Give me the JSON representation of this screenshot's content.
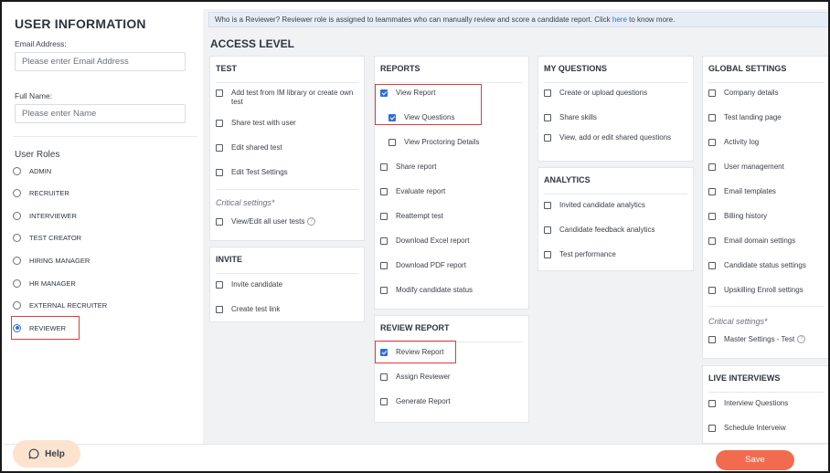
{
  "user_info": {
    "title": "USER INFORMATION",
    "email_label": "Email Address:",
    "email_placeholder": "Please enter Email Address",
    "name_label": "Full Name:",
    "name_placeholder": "Please enter Name",
    "roles_heading": "User Roles",
    "roles": [
      {
        "label": "ADMIN",
        "selected": false
      },
      {
        "label": "RECRUITER",
        "selected": false
      },
      {
        "label": "INTERVIEWER",
        "selected": false
      },
      {
        "label": "TEST CREATOR",
        "selected": false
      },
      {
        "label": "HIRING MANAGER",
        "selected": false
      },
      {
        "label": "HR MANAGER",
        "selected": false
      },
      {
        "label": "EXTERNAL RECRUITER",
        "selected": false
      },
      {
        "label": "REVIEWER",
        "selected": true
      }
    ]
  },
  "banner": {
    "text_before": "Who is a Reviewer?  Reviewer role is assigned to teammates who can manually review and score a candidate report. Click ",
    "link": "here",
    "text_after": " to know more."
  },
  "access_title": "ACCESS LEVEL",
  "test": {
    "title": "TEST",
    "items": [
      {
        "label": "Add test from IM library or create own test",
        "checked": false
      },
      {
        "label": "Share test with user",
        "checked": false
      },
      {
        "label": "Edit shared test",
        "checked": false
      },
      {
        "label": "Edit Test Settings",
        "checked": false
      }
    ],
    "critical_label": "Critical settings*",
    "critical_items": [
      {
        "label": "View/Edit all user tests",
        "checked": false,
        "help_icon": "question-circle-icon"
      }
    ]
  },
  "invite": {
    "title": "INVITE",
    "items": [
      {
        "label": "Invite candidate",
        "checked": false
      },
      {
        "label": "Create test link",
        "checked": false
      }
    ]
  },
  "reports": {
    "title": "REPORTS",
    "items": [
      {
        "label": "View Report",
        "checked": true
      },
      {
        "label": "View Questions",
        "checked": true
      },
      {
        "label": "View Proctoring Details",
        "checked": false
      },
      {
        "label": "Share report",
        "checked": false
      },
      {
        "label": "Evaluate report",
        "checked": false
      },
      {
        "label": "Reattempt test",
        "checked": false
      },
      {
        "label": "Download Excel report",
        "checked": false
      },
      {
        "label": "Download PDF report",
        "checked": false
      },
      {
        "label": "Modify candidate status",
        "checked": false
      }
    ]
  },
  "review_report": {
    "title": "REVIEW REPORT",
    "items": [
      {
        "label": "Review Report",
        "checked": true
      },
      {
        "label": "Assign Reviewer",
        "checked": false
      },
      {
        "label": "Generate Report",
        "checked": false
      }
    ]
  },
  "my_questions": {
    "title": "MY QUESTIONS",
    "items": [
      {
        "label": "Create or upload questions",
        "checked": false
      },
      {
        "label": "Share skills",
        "checked": false
      },
      {
        "label": "View, add or edit shared questions",
        "checked": false
      }
    ]
  },
  "analytics": {
    "title": "ANALYTICS",
    "items": [
      {
        "label": "Invited candidate analytics",
        "checked": false
      },
      {
        "label": "Candidate feedback analytics",
        "checked": false
      },
      {
        "label": "Test performance",
        "checked": false
      }
    ]
  },
  "global_settings": {
    "title": "GLOBAL SETTINGS",
    "items": [
      {
        "label": "Company details",
        "checked": false
      },
      {
        "label": "Test landing page",
        "checked": false
      },
      {
        "label": "Activity log",
        "checked": false
      },
      {
        "label": "User management",
        "checked": false
      },
      {
        "label": "Email templates",
        "checked": false
      },
      {
        "label": "Billing history",
        "checked": false
      },
      {
        "label": "Email domain settings",
        "checked": false
      },
      {
        "label": "Candidate status settings",
        "checked": false
      },
      {
        "label": "Upskilling Enroll settings",
        "checked": false
      }
    ],
    "critical_label": "Critical settings*",
    "critical_items": [
      {
        "label": "Master Settings - Test",
        "checked": false,
        "help_icon": "question-circle-icon"
      }
    ]
  },
  "live_interviews": {
    "title": "LIVE INTERVIEWS",
    "items": [
      {
        "label": "Interview Questions",
        "checked": false
      },
      {
        "label": "Schedule Interveiw",
        "checked": false
      }
    ]
  },
  "footer": {
    "help_label": "Help",
    "help_icon": "chat-bubble-icon",
    "save_label": "Save"
  },
  "colors": {
    "accent": "#2f6fd6",
    "save": "#f26b4e",
    "help_bg": "#fbe3cf",
    "highlight": "#e03b3b"
  }
}
